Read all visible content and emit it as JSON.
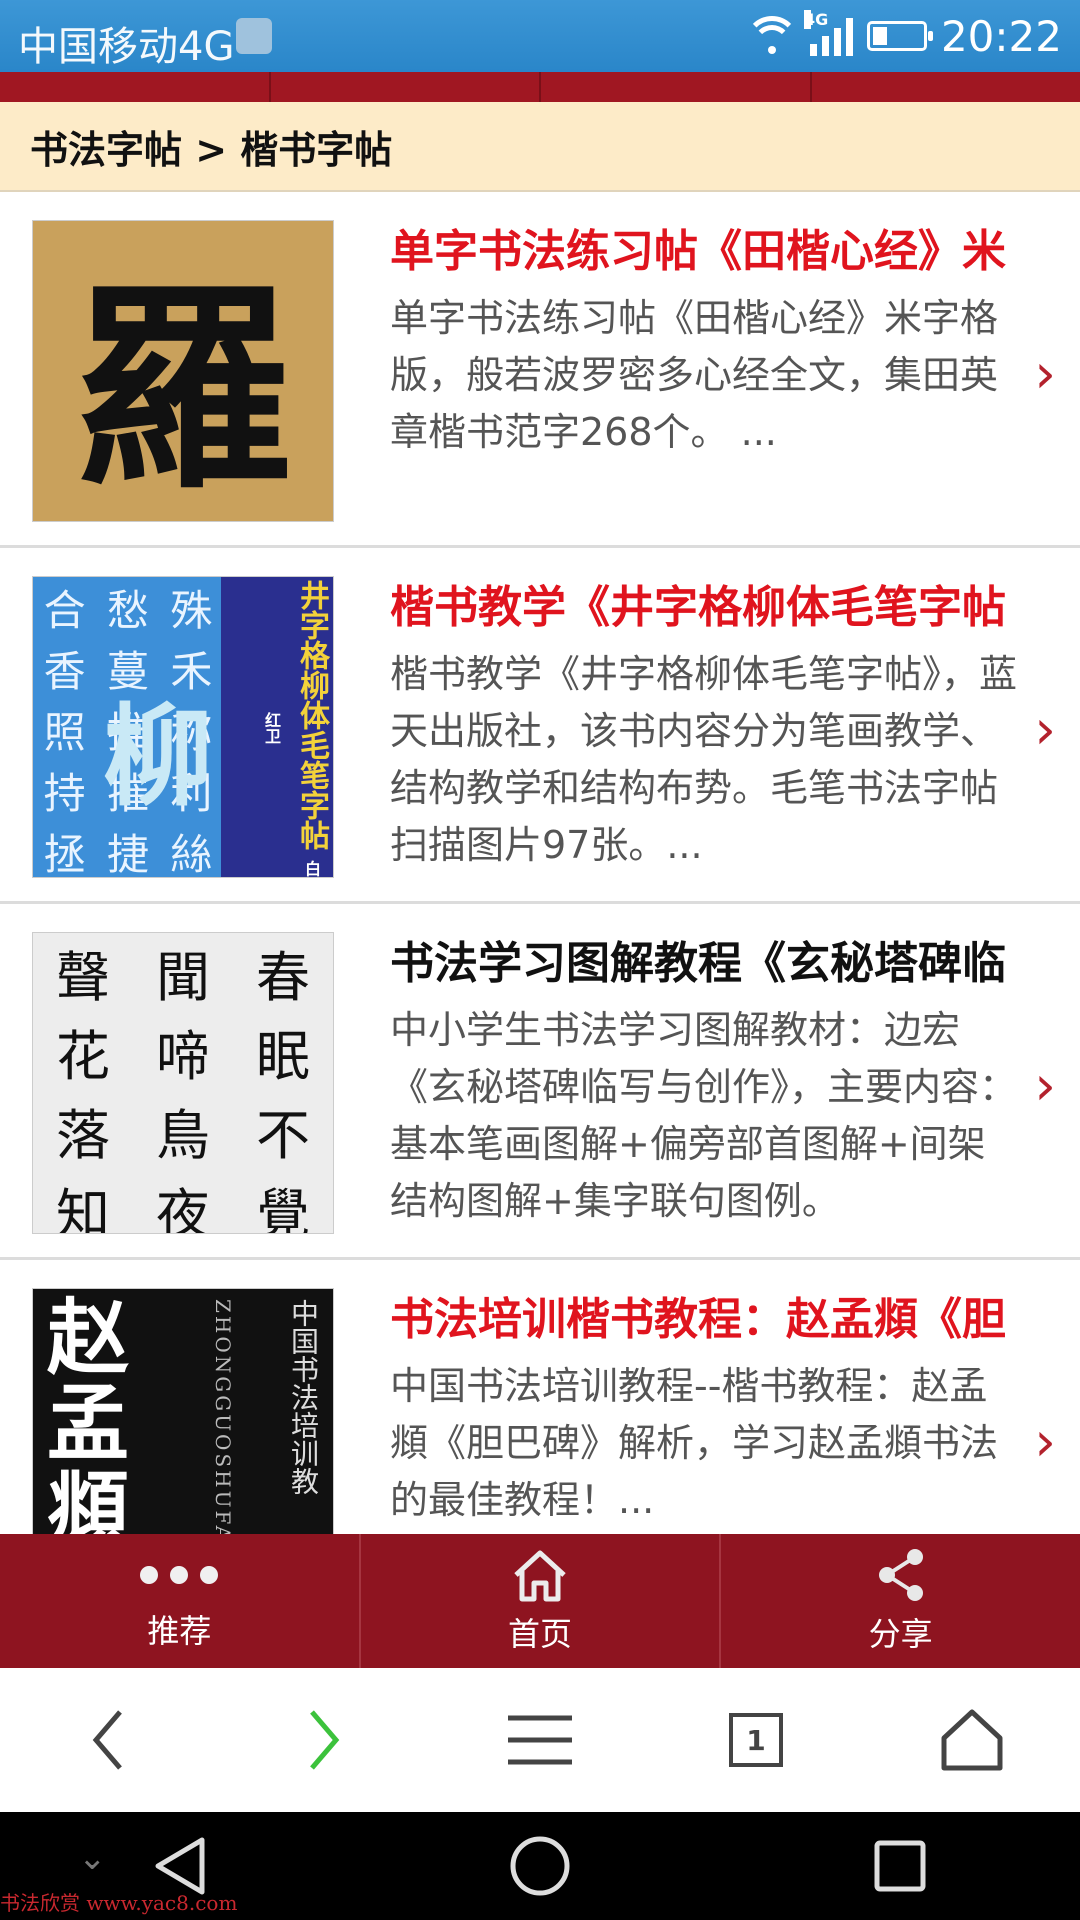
{
  "status": {
    "carrier": "中国移动4G",
    "network": "4G",
    "time": "20:22"
  },
  "breadcrumb": "书法字帖 > 楷书字帖",
  "items": [
    {
      "title": "单字书法练习帖《田楷心经》米",
      "title_color": "#e0141e",
      "desc": "单字书法练习帖《田楷心经》米字格版，般若波罗密多心经全文，集田英章楷书范字268个。 ...",
      "thumb": {
        "chars": [
          "羅"
        ]
      }
    },
    {
      "title": "楷书教学《井字格柳体毛笔字帖",
      "title_color": "#e0141e",
      "desc": "楷书教学《井字格柳体毛笔字帖》，蓝天出版社，该书内容分为笔画教学、结构教学和结构布势。毛笔书法字帖扫描图片97张。...",
      "thumb": {
        "grid": [
          "合",
          "愁",
          "殊",
          "香",
          "蔓",
          "禾",
          "照",
          "推",
          "称",
          "持",
          "摧",
          "利",
          "拯",
          "捷",
          "絲"
        ],
        "big": "柳",
        "side": "井字格柳体毛笔字帖",
        "corner": "白红卫"
      }
    },
    {
      "title": "书法学习图解教程《玄秘塔碑临",
      "title_color": "#111111",
      "desc": "中小学生书法学习图解教材：边宏《玄秘塔碑临写与创作》，主要内容：基本笔画图解+偏旁部首图解+间架结构图解+集字联句图例。",
      "thumb": {
        "grid": [
          "聲",
          "聞",
          "春",
          "花",
          "啼",
          "眠",
          "落",
          "鳥",
          "不",
          "知",
          "夜",
          "覺"
        ]
      }
    },
    {
      "title": "书法培训楷书教程：赵孟頫《胆",
      "title_color": "#e0141e",
      "desc": "中国书法培训教程--楷书教程：赵孟頫《胆巴碑》解析，学习赵孟頫书法的最佳教程！...",
      "thumb": {
        "big": "赵孟頫",
        "pinyin": "ZHONGGUOSHUFAPEIXUNJIAOCHENG",
        "cn": "中国书法培训教"
      }
    }
  ],
  "appbar": {
    "recommend": "推荐",
    "home": "首页",
    "share": "分享"
  },
  "browser": {
    "tabs_count": "1"
  },
  "watermark": "书法欣赏 www.yac8.com",
  "colors": {
    "accent": "#8e1420",
    "status_bar": "#2a86c9",
    "breadcrumb_bg": "#fdebc8"
  }
}
